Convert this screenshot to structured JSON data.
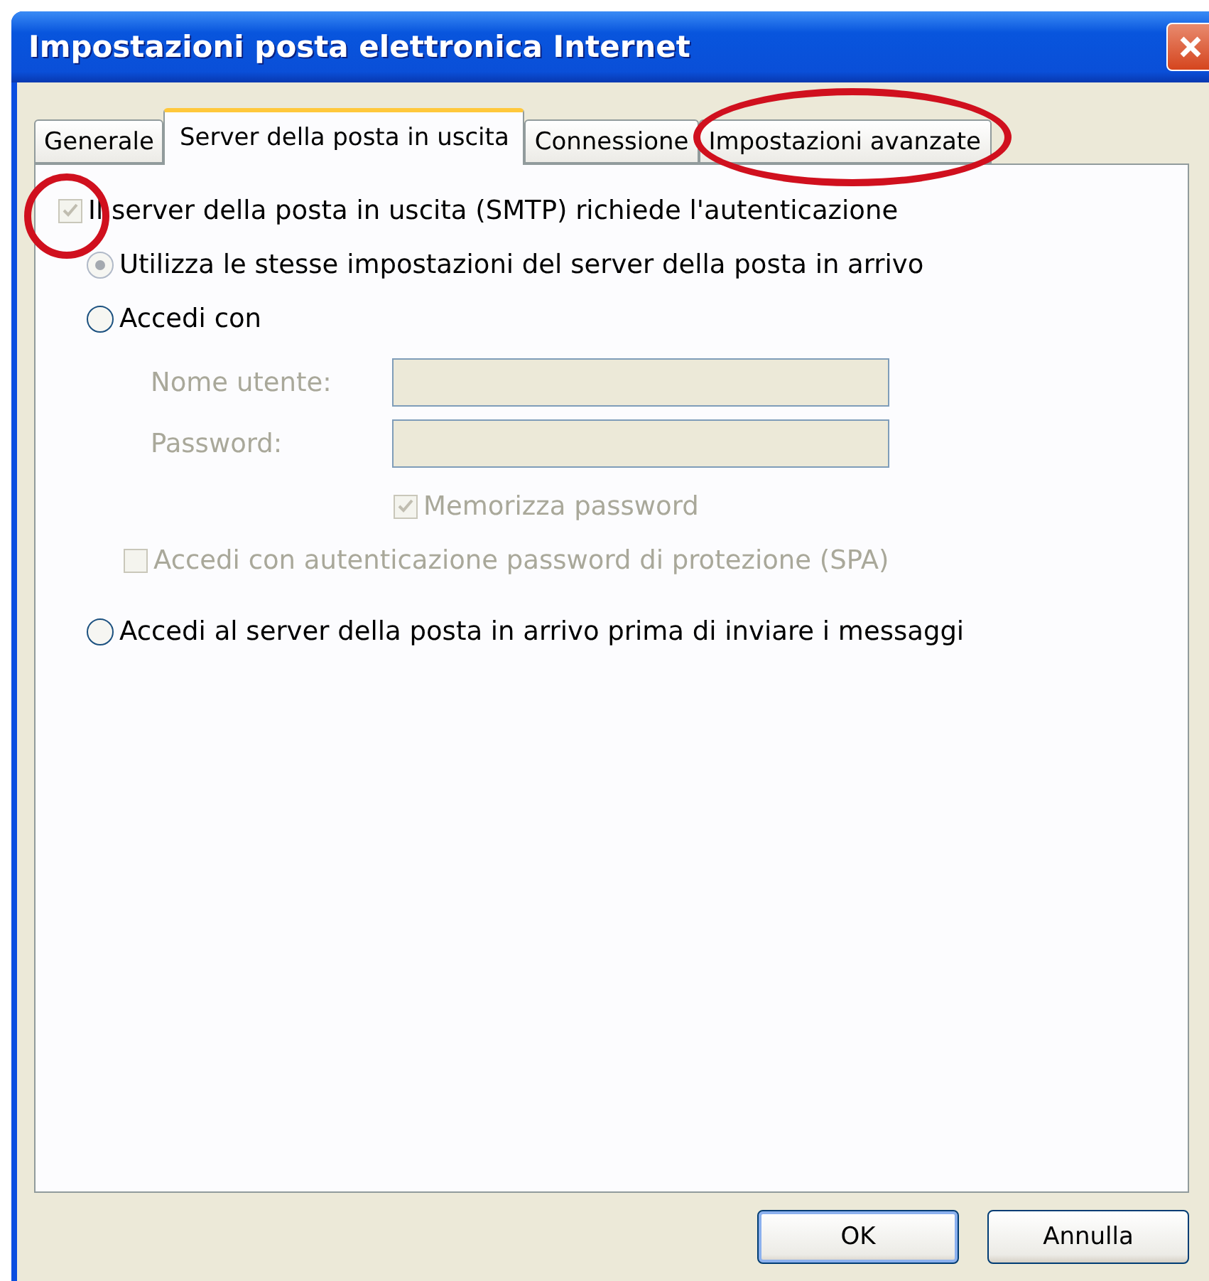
{
  "window": {
    "title": "Impostazioni posta elettronica Internet"
  },
  "tabs": [
    {
      "label": "Generale",
      "selected": false,
      "circled": false
    },
    {
      "label": "Server della posta in uscita",
      "selected": true,
      "circled": false
    },
    {
      "label": "Connessione",
      "selected": false,
      "circled": false
    },
    {
      "label": "Impostazioni avanzate",
      "selected": false,
      "circled": true
    }
  ],
  "auth_checkbox": {
    "label": "Il server della posta in uscita (SMTP) richiede l'autenticazione",
    "checked": true,
    "disabled": true,
    "circled": true
  },
  "options": [
    {
      "kind": "radio",
      "label": "Utilizza le stesse impostazioni del server della posta in arrivo",
      "selected": true,
      "disabled": true
    },
    {
      "kind": "radio",
      "label": "Accedi con",
      "selected": false,
      "disabled": false
    }
  ],
  "fields": [
    {
      "label": "Nome utente:",
      "disabled": true
    },
    {
      "label": "Password:",
      "disabled": true
    }
  ],
  "sub_checkboxes": [
    {
      "label": "Memorizza password",
      "checked": true,
      "disabled": true
    },
    {
      "label": "Accedi con autenticazione password di protezione (SPA)",
      "checked": false,
      "disabled": true
    }
  ],
  "last_option": {
    "kind": "radio",
    "label": "Accedi al server della posta in arrivo prima di inviare i messaggi",
    "selected": false,
    "disabled": false
  },
  "buttons": [
    {
      "label": "OK",
      "default": true
    },
    {
      "label": "Annulla",
      "default": false
    }
  ]
}
